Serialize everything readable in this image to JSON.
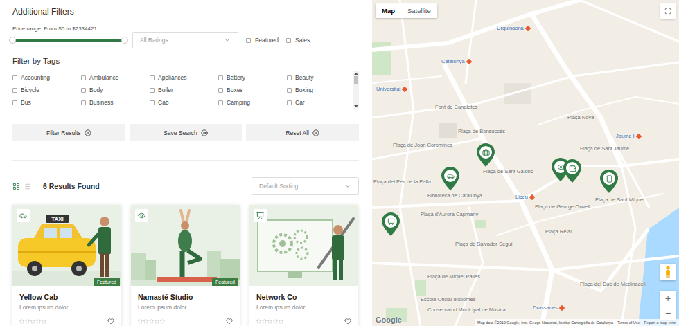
{
  "filters": {
    "title": "Additional Filters",
    "price": {
      "label": "Price range: From $0 to $2334421",
      "low": 0,
      "level": 1
    },
    "rating": {
      "placeholder": "All Ratings"
    },
    "options": [
      {
        "label": "Featured",
        "checked": false
      },
      {
        "label": "Sales",
        "checked": false
      }
    ]
  },
  "tags": {
    "title": "Filter by Tags",
    "items": [
      {
        "label": "Accounting",
        "checked": false
      },
      {
        "label": "Ambulance",
        "checked": false
      },
      {
        "label": "Appliances",
        "checked": false
      },
      {
        "label": "Battery",
        "checked": false
      },
      {
        "label": "Beauty",
        "checked": false
      },
      {
        "label": "Bicycle",
        "checked": false
      },
      {
        "label": "Body",
        "checked": false
      },
      {
        "label": "Boiler",
        "checked": false
      },
      {
        "label": "Boxes",
        "checked": false
      },
      {
        "label": "Boxing",
        "checked": false
      },
      {
        "label": "Bus",
        "checked": false
      },
      {
        "label": "Business",
        "checked": false
      },
      {
        "label": "Cab",
        "checked": false
      },
      {
        "label": "Camping",
        "checked": false
      },
      {
        "label": "Car",
        "checked": false
      }
    ]
  },
  "actions": [
    {
      "label": "Filter Results"
    },
    {
      "label": "Save Search"
    },
    {
      "label": "Reset All"
    }
  ],
  "results": {
    "count": "6 Results Found",
    "sort": "Default Sorting",
    "views": [
      {
        "kind": "grid",
        "selected": true
      },
      {
        "kind": "list",
        "selected": false
      }
    ]
  },
  "cards": [
    {
      "title": "Yellow Cab",
      "description": "Lorem ipsum dolor",
      "kind": "taxi",
      "sign": "TAXI",
      "featured": true,
      "badge": "Featured",
      "stars": 0,
      "favorite": false
    },
    {
      "title": "Namasté Studio",
      "description": "Lorem ipsum dolor",
      "kind": "yoga",
      "featured": true,
      "badge": "Featured",
      "stars": 0,
      "favorite": false
    },
    {
      "title": "Network Co",
      "description": "Lorem ipsum dolor",
      "kind": "network",
      "featured": false,
      "stars": 0,
      "favorite": false
    }
  ],
  "map": {
    "tabs": [
      {
        "label": "Map",
        "selected": true
      },
      {
        "label": "Satellite",
        "selected": false
      }
    ],
    "labels": [
      {
        "text": "Urquinaona",
        "kind": "metro"
      },
      {
        "text": "Catalunya",
        "kind": "metro"
      },
      {
        "text": "Universitat",
        "kind": "metro"
      },
      {
        "text": "Font de Canaletes",
        "kind": "place"
      },
      {
        "text": "Plaça de Bonsuccés",
        "kind": "place"
      },
      {
        "text": "Plaça de Joan Coromines",
        "kind": "place"
      },
      {
        "text": "Plaça Nova",
        "kind": "place"
      },
      {
        "text": "Plaça de Sant Jaume",
        "kind": "place"
      },
      {
        "text": "Jaume I",
        "kind": "metro"
      },
      {
        "text": "Plaça de Sant Galdric",
        "kind": "place"
      },
      {
        "text": "Plaça del Pes de la Palla",
        "kind": "place"
      },
      {
        "text": "Biblioteca de Catalunya",
        "kind": "place"
      },
      {
        "text": "Liceu",
        "kind": "metro"
      },
      {
        "text": "Plaça de Sant Miquel",
        "kind": "place"
      },
      {
        "text": "Plaça de George Orwell",
        "kind": "place"
      },
      {
        "text": "Plaça Reial",
        "kind": "place"
      },
      {
        "text": "Plaça d'Aurora Capmany",
        "kind": "place"
      },
      {
        "text": "Plaça de Salvador Seguí",
        "kind": "place"
      },
      {
        "text": "Plaça de Miquel Pallès",
        "kind": "place"
      },
      {
        "text": "Plaça del Duc de Medinaceli",
        "kind": "place"
      },
      {
        "text": "Escola Oficial d'Idiomes",
        "kind": "place"
      },
      {
        "text": "Drassanes",
        "kind": "metro"
      },
      {
        "text": "Conservatori Municipal de Música",
        "kind": "place"
      }
    ],
    "pins": [
      {
        "kind": "briefcase"
      },
      {
        "kind": "car"
      },
      {
        "kind": "eye"
      },
      {
        "kind": "wallet"
      },
      {
        "kind": "phone"
      },
      {
        "kind": "network"
      }
    ],
    "zoom": [
      "+",
      "−"
    ],
    "logo": "Google",
    "attribution": [
      "Map data ©2019 Google, Inst. Geogr. Nacional, Institut Cartogràfic de Catalunya",
      "Terms of Use",
      "Report a map error"
    ]
  }
}
